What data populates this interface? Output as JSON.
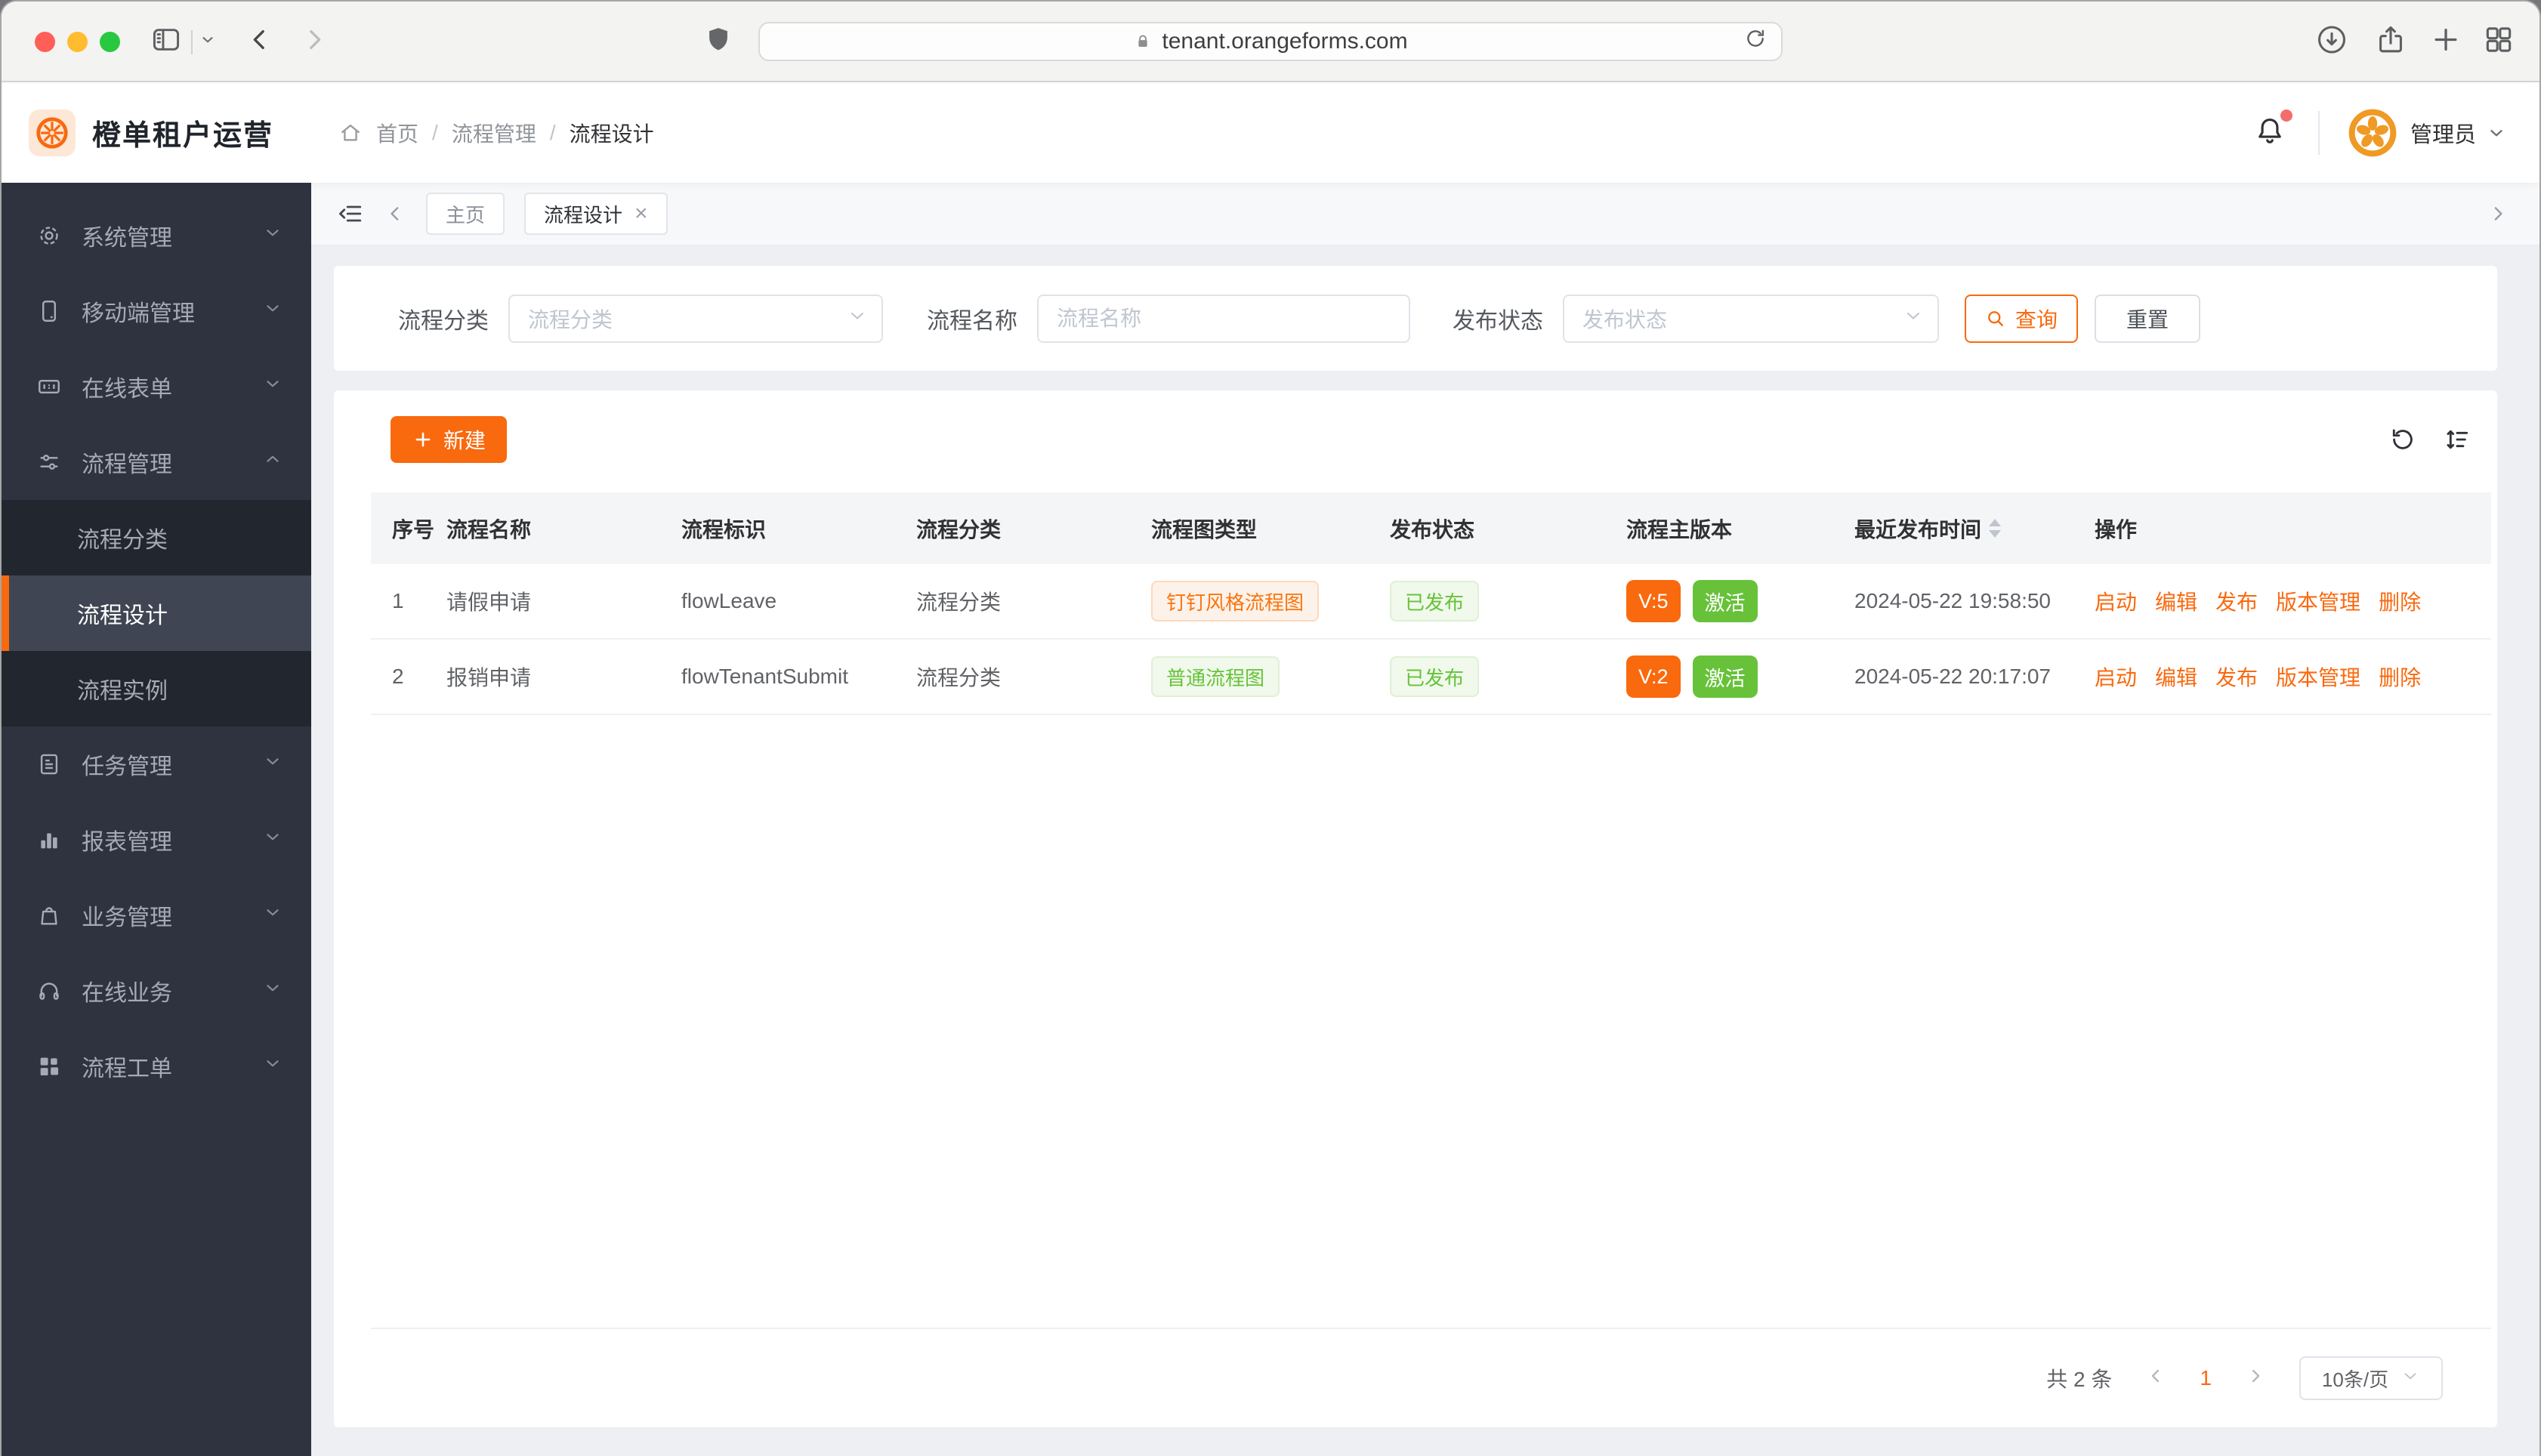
{
  "browser": {
    "url": "tenant.orangeforms.com"
  },
  "app_header": {
    "title": "橙单租户运营",
    "breadcrumb": {
      "home": "首页",
      "section": "流程管理",
      "current": "流程设计",
      "separator": "/"
    },
    "user_name": "管理员"
  },
  "sidebar": {
    "items": [
      {
        "label": "系统管理"
      },
      {
        "label": "移动端管理"
      },
      {
        "label": "在线表单"
      },
      {
        "label": "流程管理"
      },
      {
        "label": "任务管理"
      },
      {
        "label": "报表管理"
      },
      {
        "label": "业务管理"
      },
      {
        "label": "在线业务"
      },
      {
        "label": "流程工单"
      }
    ],
    "submenu": [
      {
        "label": "流程分类"
      },
      {
        "label": "流程设计"
      },
      {
        "label": "流程实例"
      }
    ]
  },
  "tabbar": {
    "tabs": [
      {
        "label": "主页"
      },
      {
        "label": "流程设计",
        "close": "×"
      }
    ]
  },
  "filters": {
    "category_label": "流程分类",
    "category_placeholder": "流程分类",
    "name_label": "流程名称",
    "name_placeholder": "流程名称",
    "status_label": "发布状态",
    "status_placeholder": "发布状态",
    "query_button": "查询",
    "reset_button": "重置"
  },
  "toolbar": {
    "new_button": "新建"
  },
  "table": {
    "columns": [
      "序号",
      "流程名称",
      "流程标识",
      "流程分类",
      "流程图类型",
      "发布状态",
      "流程主版本",
      "最近发布时间",
      "操作"
    ],
    "rows": [
      {
        "seq": "1",
        "name": "请假申请",
        "key": "flowLeave",
        "category": "流程分类",
        "diagram_type": "钉钉风格流程图",
        "publish_status": "已发布",
        "version": "V:5",
        "active_state": "激活",
        "published_at": "2024-05-22 19:58:50",
        "actions": [
          "启动",
          "编辑",
          "发布",
          "版本管理",
          "删除"
        ]
      },
      {
        "seq": "2",
        "name": "报销申请",
        "key": "flowTenantSubmit",
        "category": "流程分类",
        "diagram_type": "普通流程图",
        "publish_status": "已发布",
        "version": "V:2",
        "active_state": "激活",
        "published_at": "2024-05-22 20:17:07",
        "actions": [
          "启动",
          "编辑",
          "发布",
          "版本管理",
          "删除"
        ]
      }
    ]
  },
  "pagination": {
    "total": "共 2 条",
    "page": "1",
    "page_size": "10条/页"
  },
  "colors": {
    "primary": "#f9690e",
    "green": "#67c23a",
    "sidebar": "#2e333f"
  }
}
